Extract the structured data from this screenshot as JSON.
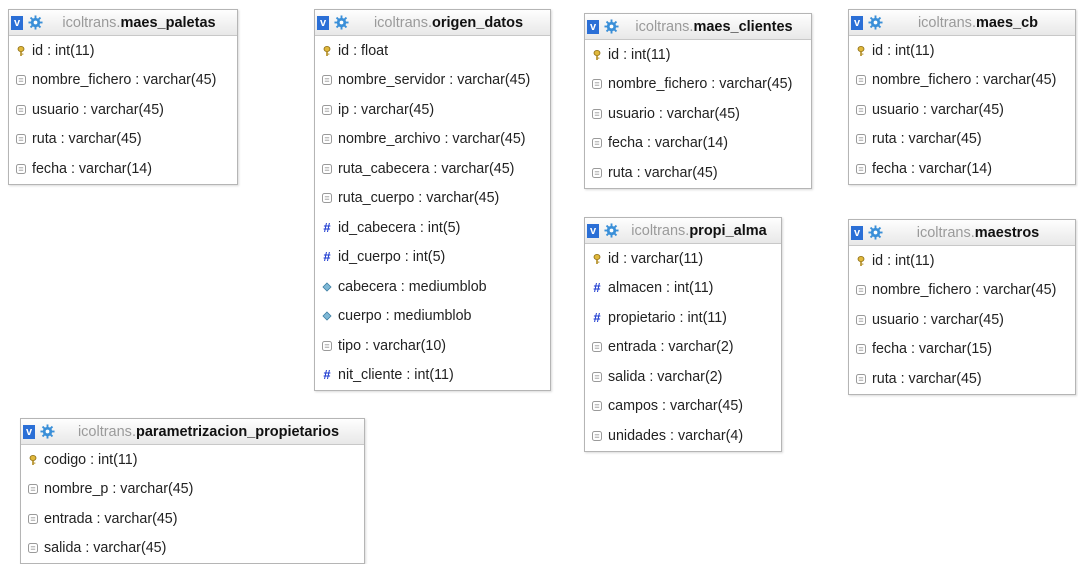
{
  "tables": [
    {
      "id": "maes_paletas",
      "db": "icoltrans",
      "name": "maes_paletas",
      "columns": [
        {
          "text": "id : int(11)",
          "icon": "primary-key-icon"
        },
        {
          "text": "nombre_fichero : varchar(45)",
          "icon": "column-icon"
        },
        {
          "text": "usuario : varchar(45)",
          "icon": "column-icon"
        },
        {
          "text": "ruta : varchar(45)",
          "icon": "column-icon"
        },
        {
          "text": "fecha : varchar(14)",
          "icon": "column-icon"
        }
      ]
    },
    {
      "id": "origen_datos",
      "db": "icoltrans",
      "name": "origen_datos",
      "columns": [
        {
          "text": "id : float",
          "icon": "primary-key-icon"
        },
        {
          "text": "nombre_servidor : varchar(45)",
          "icon": "column-icon"
        },
        {
          "text": "ip : varchar(45)",
          "icon": "column-icon"
        },
        {
          "text": "nombre_archivo : varchar(45)",
          "icon": "column-icon"
        },
        {
          "text": "ruta_cabecera : varchar(45)",
          "icon": "column-icon"
        },
        {
          "text": "ruta_cuerpo : varchar(45)",
          "icon": "column-icon"
        },
        {
          "text": "id_cabecera : int(5)",
          "icon": "numeric-icon"
        },
        {
          "text": "id_cuerpo : int(5)",
          "icon": "numeric-icon"
        },
        {
          "text": "cabecera : mediumblob",
          "icon": "blob-icon"
        },
        {
          "text": "cuerpo : mediumblob",
          "icon": "blob-icon"
        },
        {
          "text": "tipo : varchar(10)",
          "icon": "column-icon"
        },
        {
          "text": "nit_cliente : int(11)",
          "icon": "numeric-icon"
        }
      ]
    },
    {
      "id": "maes_clientes",
      "db": "icoltrans",
      "name": "maes_clientes",
      "columns": [
        {
          "text": "id : int(11)",
          "icon": "primary-key-icon"
        },
        {
          "text": "nombre_fichero : varchar(45)",
          "icon": "column-icon"
        },
        {
          "text": "usuario : varchar(45)",
          "icon": "column-icon"
        },
        {
          "text": "fecha : varchar(14)",
          "icon": "column-icon"
        },
        {
          "text": "ruta : varchar(45)",
          "icon": "column-icon"
        }
      ]
    },
    {
      "id": "maes_cb",
      "db": "icoltrans",
      "name": "maes_cb",
      "columns": [
        {
          "text": "id : int(11)",
          "icon": "primary-key-icon"
        },
        {
          "text": "nombre_fichero : varchar(45)",
          "icon": "column-icon"
        },
        {
          "text": "usuario : varchar(45)",
          "icon": "column-icon"
        },
        {
          "text": "ruta : varchar(45)",
          "icon": "column-icon"
        },
        {
          "text": "fecha : varchar(14)",
          "icon": "column-icon"
        }
      ]
    },
    {
      "id": "propi_alma",
      "db": "icoltrans",
      "name": "propi_alma",
      "columns": [
        {
          "text": "id : varchar(11)",
          "icon": "primary-key-icon"
        },
        {
          "text": "almacen : int(11)",
          "icon": "numeric-icon"
        },
        {
          "text": "propietario : int(11)",
          "icon": "numeric-icon"
        },
        {
          "text": "entrada : varchar(2)",
          "icon": "column-icon"
        },
        {
          "text": "salida : varchar(2)",
          "icon": "column-icon"
        },
        {
          "text": "campos : varchar(45)",
          "icon": "column-icon"
        },
        {
          "text": "unidades : varchar(4)",
          "icon": "column-icon"
        }
      ]
    },
    {
      "id": "maestros",
      "db": "icoltrans",
      "name": "maestros",
      "columns": [
        {
          "text": "id : int(11)",
          "icon": "primary-key-icon"
        },
        {
          "text": "nombre_fichero : varchar(45)",
          "icon": "column-icon"
        },
        {
          "text": "usuario : varchar(45)",
          "icon": "column-icon"
        },
        {
          "text": "fecha : varchar(15)",
          "icon": "column-icon"
        },
        {
          "text": "ruta : varchar(45)",
          "icon": "column-icon"
        }
      ]
    },
    {
      "id": "parametrizacion_propietarios",
      "db": "icoltrans",
      "name": "parametrizacion_propietarios",
      "columns": [
        {
          "text": "codigo : int(11)",
          "icon": "primary-key-icon"
        },
        {
          "text": "nombre_p : varchar(45)",
          "icon": "column-icon"
        },
        {
          "text": "entrada : varchar(45)",
          "icon": "column-icon"
        },
        {
          "text": "salida : varchar(45)",
          "icon": "column-icon"
        }
      ]
    }
  ],
  "toggle_label": "v",
  "colors": {
    "toggle_bg": "#2b6fd6",
    "db_name": "#9a9a9a",
    "key": "#c9a227",
    "numeric": "#1a38d0",
    "blob": "#4f93b5",
    "column": "#9a9a9a"
  }
}
